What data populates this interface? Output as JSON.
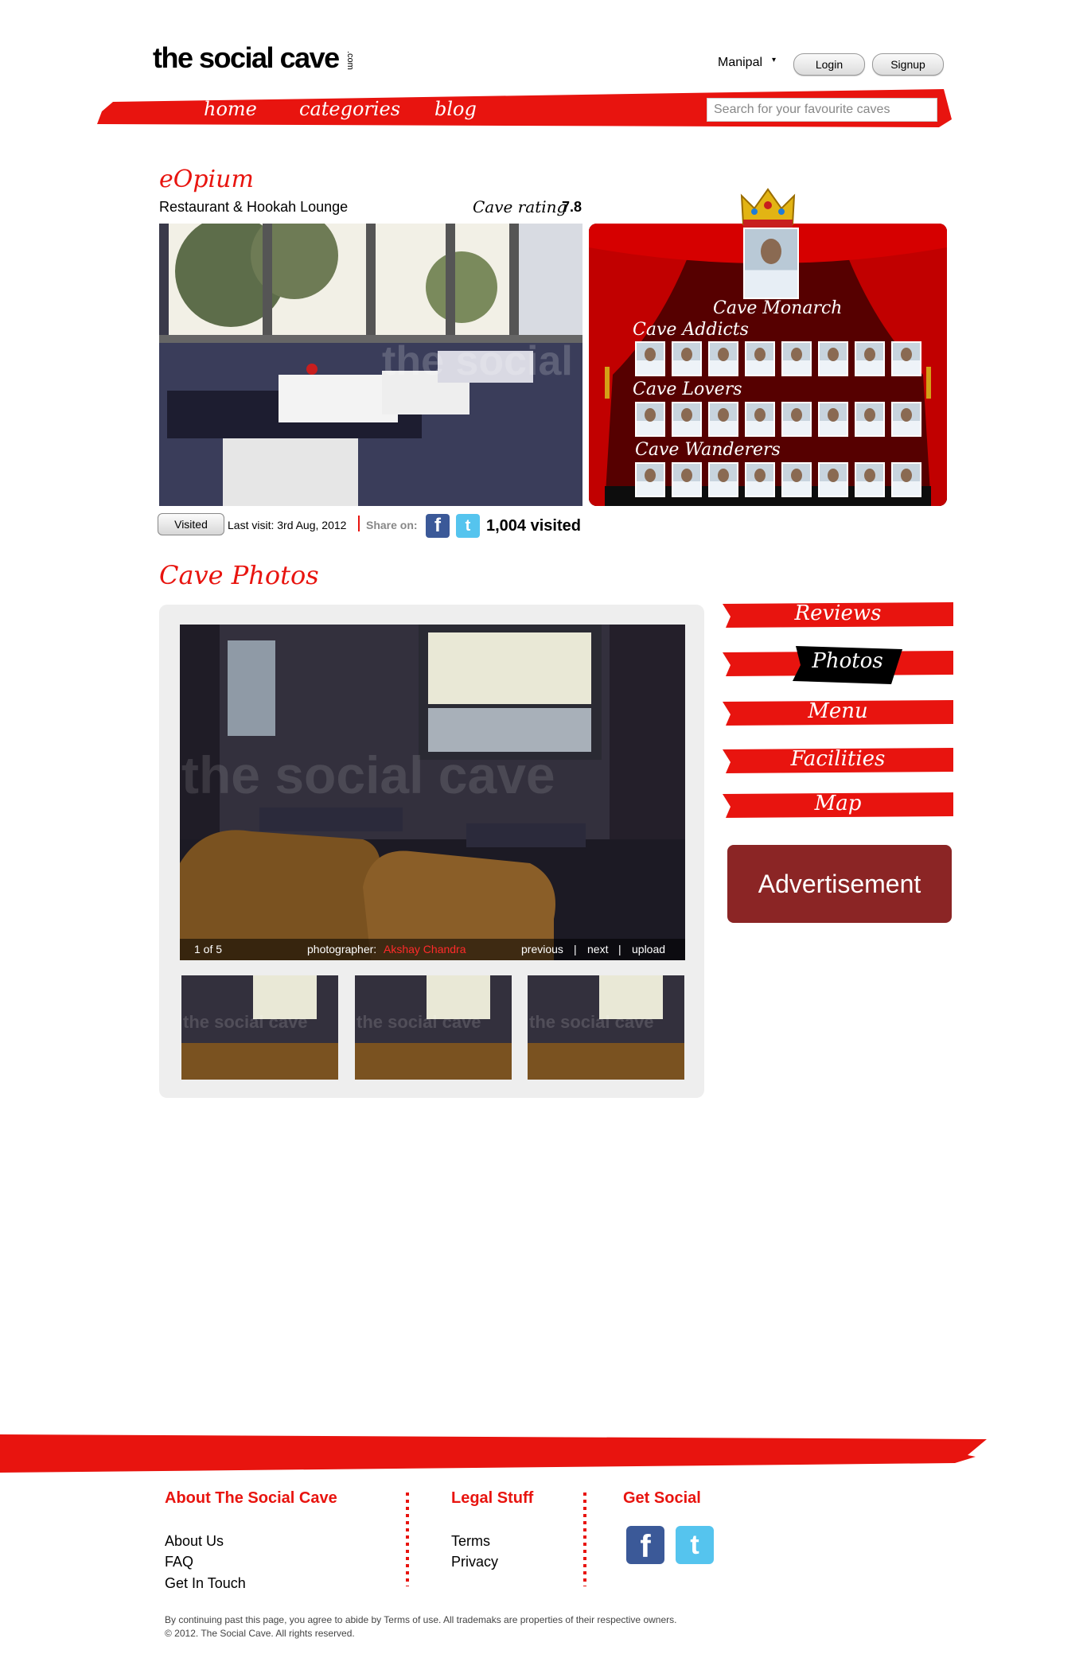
{
  "header": {
    "logo_text": "the social cave",
    "logo_suffix": ".com",
    "city": "Manipal",
    "login_label": "Login",
    "signup_label": "Signup"
  },
  "nav": {
    "items": [
      {
        "label": "home"
      },
      {
        "label": "categories"
      },
      {
        "label": "blog"
      }
    ],
    "search_placeholder": "Search for your favourite caves"
  },
  "cave": {
    "name": "eOpium",
    "type": "Restaurant & Hookah Lounge",
    "rating_label": "Cave rating",
    "rating_value": "7.8",
    "photo_watermark": "the social cave"
  },
  "stage": {
    "monarch_label": "Cave Monarch",
    "groups": [
      {
        "label": "Cave Addicts",
        "count": 8
      },
      {
        "label": "Cave Lovers",
        "count": 8
      },
      {
        "label": "Cave Wanderers",
        "count": 8
      }
    ]
  },
  "visit": {
    "visited_button": "Visited",
    "last_visit": "Last visit: 3rd Aug, 2012",
    "share_label": "Share on:",
    "facebook_glyph": "f",
    "twitter_glyph": "t",
    "visited_count": "1,004 visited"
  },
  "photos": {
    "section_title": "Cave Photos",
    "watermark": "the social cave",
    "counter": "1 of 5",
    "photographer_label": "photographer:",
    "photographer_name": "Akshay Chandra",
    "previous_label": "previous",
    "next_label": "next",
    "upload_label": "upload",
    "divider": "|"
  },
  "tabs": [
    {
      "label": "Reviews",
      "active": false
    },
    {
      "label": "Photos",
      "active": true
    },
    {
      "label": "Menu",
      "active": false
    },
    {
      "label": "Facilities",
      "active": false
    },
    {
      "label": "Map",
      "active": false
    }
  ],
  "advertisement": "Advertisement",
  "footer": {
    "about_title": "About The Social Cave",
    "about_links": [
      "About Us",
      "FAQ",
      "Get In Touch"
    ],
    "legal_title": "Legal Stuff",
    "legal_links": [
      "Terms",
      "Privacy"
    ],
    "social_title": "Get Social",
    "facebook_glyph": "f",
    "twitter_glyph": "t",
    "disclaimer": "By continuing past this page, you agree to abide by Terms of use. All trademaks are properties of their respective owners.",
    "copyright": "© 2012. The Social Cave. All rights reserved."
  },
  "colors": {
    "brand_red": "#e8140f",
    "advert_bg": "#8b2525",
    "stage_red": "#b00000"
  }
}
